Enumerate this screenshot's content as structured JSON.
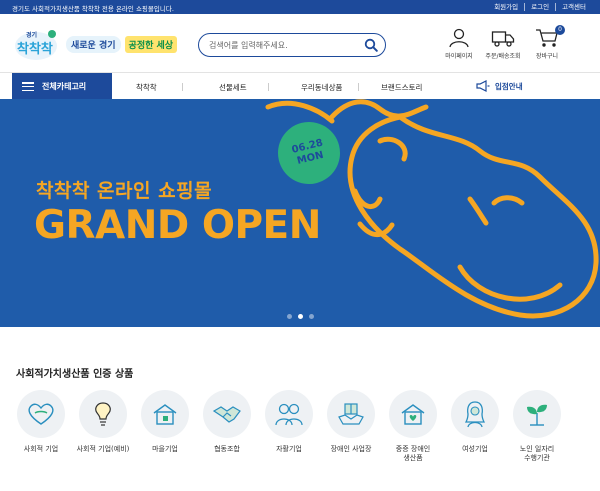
{
  "topbar": {
    "notice": "경기도 사회적가치생산품 착착착 전용 온라인 쇼핑몰입니다.",
    "links": [
      "회원가입",
      "로그인",
      "고객센터"
    ]
  },
  "header": {
    "logo": {
      "top": "경기",
      "main": "착착착",
      "icon": "logo-mark"
    },
    "slogan": {
      "part1": "새로운 경기",
      "part2": "공정한 세상"
    },
    "search": {
      "placeholder": "검색어를 입력해주세요.",
      "value": ""
    },
    "icons": [
      {
        "label": "마이페이지",
        "icon": "person-icon"
      },
      {
        "label": "주문/배송조회",
        "icon": "truck-icon"
      },
      {
        "label": "장바구니",
        "icon": "cart-icon",
        "badge": "0"
      }
    ]
  },
  "nav": {
    "category_label": "전체카테고리",
    "items": [
      "착착착",
      "선물세트",
      "우리동네상품",
      "브랜드스토리"
    ],
    "enter_label": "입점안내"
  },
  "banner": {
    "date": "06.28",
    "day": "MON",
    "title": "착착착 온라인 쇼핑몰",
    "headline": "GRAND OPEN",
    "slides": 3,
    "active_slide": 2,
    "colors": {
      "background": "#1f5caa",
      "accent": "#f5a623",
      "badge": "#2db07c"
    }
  },
  "certification": {
    "title": "사회적가치생산품 인증 상품",
    "items": [
      {
        "label": "사회적 기업",
        "icon": "heart-icon"
      },
      {
        "label": "사회적 기업(예비)",
        "icon": "lightbulb-icon"
      },
      {
        "label": "마을기업",
        "icon": "house-icon"
      },
      {
        "label": "협동조합",
        "icon": "handshake-icon"
      },
      {
        "label": "자활기업",
        "icon": "people-icon"
      },
      {
        "label": "장애인 사업장",
        "icon": "gift-hands-icon"
      },
      {
        "label": "중증 장애인\n생산품",
        "icon": "house-heart-icon"
      },
      {
        "label": "여성기업",
        "icon": "woman-icon"
      },
      {
        "label": "노인 일자리\n수행기관",
        "icon": "sprout-icon"
      }
    ]
  }
}
